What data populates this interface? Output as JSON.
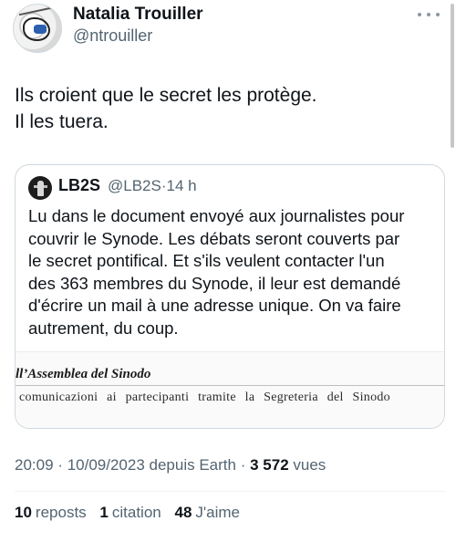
{
  "author": {
    "display_name": "Natalia Trouiller",
    "handle": "@ntrouiller",
    "avatar_icon": "cartoon-avatar-icon"
  },
  "tweet": {
    "lines": [
      "Ils croient que le secret les protège.",
      "Il les tuera."
    ]
  },
  "quoted_tweet": {
    "display_name": "LB2S",
    "handle": "@LB2S",
    "separator": "·",
    "time": "14 h",
    "lines": [
      "Lu dans le document envoyé aux journalistes pour",
      "couvrir le Synode. Les débats seront couverts par",
      "le secret pontifical.   Et s'ils veulent contacter l'un",
      "des 363 membres du Synode, il leur est demandé",
      "d'écrire un mail à une adresse unique. On va faire",
      "autrement, du coup."
    ],
    "image": {
      "heading": "ll’Assemblea del Sinodo",
      "line": "comunicazioni ai partecipanti tramite la Segreteria del Sinodo"
    }
  },
  "meta": {
    "time": "20:09",
    "date": "10/09/2023",
    "source": "depuis Earth",
    "views_count": "3 572",
    "views_label": "vues",
    "separator": "·"
  },
  "stats": {
    "reposts_count": "10",
    "reposts_label": "reposts",
    "quotes_count": "1",
    "quotes_label": "citation",
    "likes_count": "48",
    "likes_label": "J'aime"
  },
  "colors": {
    "text": "#0f1419",
    "secondary": "#536471",
    "border": "#cfd9de"
  }
}
